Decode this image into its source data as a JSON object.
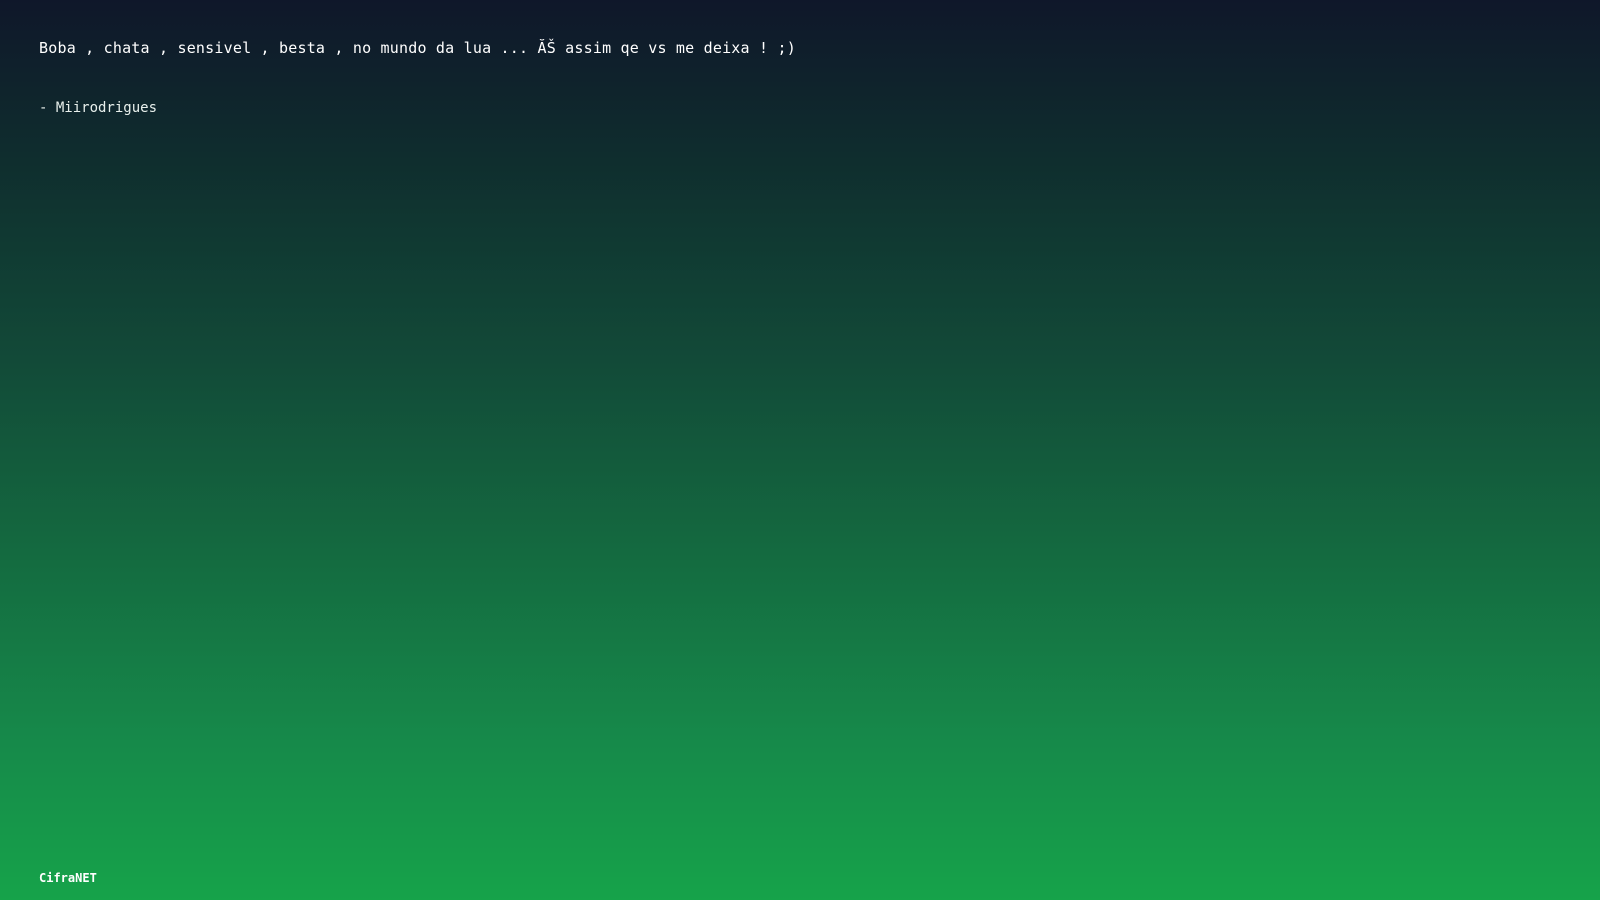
{
  "quote": {
    "text": "Boba , chata , sensivel , besta , no mundo da lua ... ĂŠ assim qe vs me deixa ! ;)",
    "author": "- Miirodrigues"
  },
  "footer": {
    "brand": "CifraNET"
  },
  "colors": {
    "gradient_top": "#0f172a",
    "gradient_bottom": "#16a34a",
    "text": "#ffffff"
  }
}
